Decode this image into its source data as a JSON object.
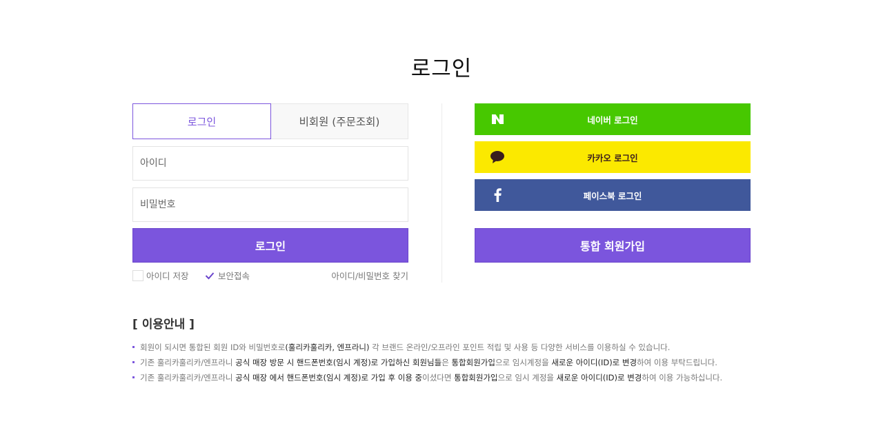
{
  "page": {
    "title": "로그인"
  },
  "tabs": {
    "member": "로그인",
    "guest": "비회원 (주문조회)"
  },
  "form": {
    "id_placeholder": "아이디",
    "pw_placeholder": "비밀번호",
    "login_button": "로그인",
    "save_id_label": "아이디 저장",
    "save_id_checked": false,
    "secure_label": "보안접속",
    "secure_checked": true,
    "find_link": "아이디/비밀번호 찾기"
  },
  "social": {
    "naver": {
      "label": "네이버 로그인",
      "icon": "naver-n-icon",
      "color": "#47c800"
    },
    "kakao": {
      "label": "카카오 로그인",
      "icon": "kakao-speech-bubble-icon",
      "color": "#fbe900"
    },
    "facebook": {
      "label": "페이스북 로그인",
      "icon": "facebook-f-icon",
      "color": "#40589b"
    }
  },
  "join_button": "통합 회원가입",
  "info": {
    "title": "[ 이용안내 ]",
    "lines": [
      [
        {
          "text": "회원이 되시면 통합된 회원 ID와 비밀번호로",
          "em": false
        },
        {
          "text": "(훌리카훌리카, 엔프라니)",
          "em": true
        },
        {
          "text": " 각 브랜드 온라인/오프라인 포인트 적립 및 사용 등 다양한 서비스를 이용하실 수 있습니다.",
          "em": false
        }
      ],
      [
        {
          "text": "기존 훌리카훌리카/엔프라니 ",
          "em": false
        },
        {
          "text": "공식 매장 방문 시 핸드폰번호(임시 계정)로 가입하신 회원님들",
          "em": true
        },
        {
          "text": "은 ",
          "em": false
        },
        {
          "text": "통합회원가입",
          "em": true
        },
        {
          "text": "으로 임시계정을 ",
          "em": false
        },
        {
          "text": "새로운 아이디(ID)로 변경",
          "em": true
        },
        {
          "text": "하여 이용 부탁드립니다.",
          "em": false
        }
      ],
      [
        {
          "text": "기존 훌리카훌리카/엔프라니 ",
          "em": false
        },
        {
          "text": "공식 매장 에서 핸드폰번호(임시 계정)로 가입 후 이용 중",
          "em": true
        },
        {
          "text": "이셨다면 ",
          "em": false
        },
        {
          "text": "통합회원가입",
          "em": true
        },
        {
          "text": "으로 임시 계정을 ",
          "em": false
        },
        {
          "text": "새로운 아이디(ID)로 변경",
          "em": true
        },
        {
          "text": "하여 이용 가능하십니다.",
          "em": false
        }
      ]
    ]
  },
  "colors": {
    "accent": "#7b55dd",
    "border": "#e3e3e3"
  }
}
